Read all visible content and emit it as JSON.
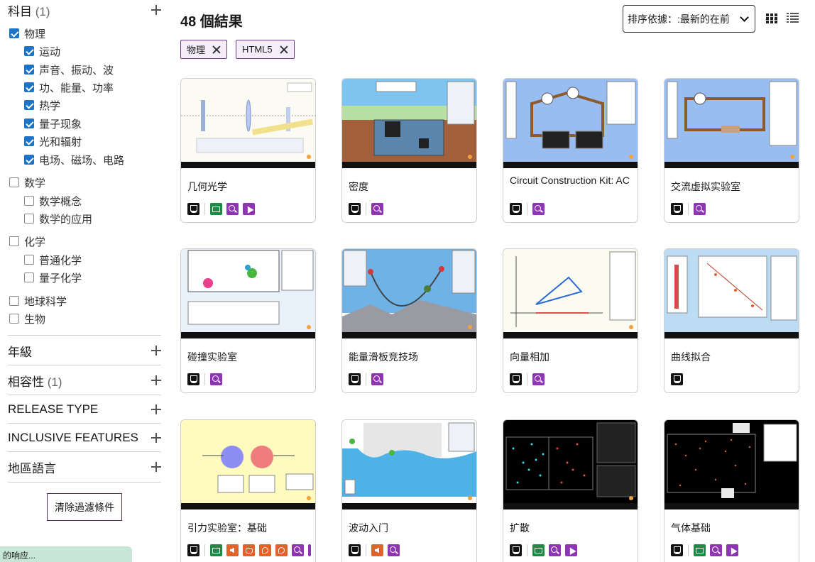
{
  "sidebar": {
    "subject": {
      "label": "科目",
      "count": "(1)"
    },
    "physics": {
      "label": "物理",
      "items": [
        "运动",
        "声音、振动、波",
        "功、能量、功率",
        "热学",
        "量子现象",
        "光和辐射",
        "电场、磁场、电路"
      ]
    },
    "math": {
      "label": "数学",
      "items": [
        "数学概念",
        "数学的应用"
      ]
    },
    "chemistry": {
      "label": "化学",
      "items": [
        "普通化学",
        "量子化学"
      ]
    },
    "earth": {
      "label": "地球科学"
    },
    "biology": {
      "label": "生物"
    },
    "facets": [
      {
        "label": "年級",
        "count": ""
      },
      {
        "label": "相容性",
        "count": "(1)"
      },
      {
        "label": "RELEASE TYPE",
        "count": ""
      },
      {
        "label": "INCLUSIVE FEATURES",
        "count": ""
      },
      {
        "label": "地區語言",
        "count": ""
      }
    ],
    "clear_label": "清除過濾條件",
    "status_text": "的响应..."
  },
  "header": {
    "results": "48 個結果",
    "sort_label": "排序依據：:最新的在前"
  },
  "chips": [
    "物理",
    "HTML5"
  ],
  "cards": [
    {
      "title": "几何光学",
      "badges": [
        "html5",
        "keyboard",
        "zoom",
        "pointer"
      ]
    },
    {
      "title": "密度",
      "badges": [
        "html5",
        "zoom"
      ]
    },
    {
      "title": "Circuit Construction Kit: AC",
      "badges": [
        "html5",
        "zoom"
      ]
    },
    {
      "title": "交流虚拟实验室",
      "badges": [
        "html5",
        "zoom"
      ]
    },
    {
      "title": "碰撞实验室",
      "badges": [
        "html5",
        "zoom"
      ]
    },
    {
      "title": "能量滑板竞技场",
      "badges": [
        "html5",
        "zoom"
      ]
    },
    {
      "title": "向量相加",
      "badges": [
        "html5",
        "zoom"
      ]
    },
    {
      "title": "曲线拟合",
      "badges": [
        "html5"
      ]
    },
    {
      "title": "引力实验室：基础",
      "badges": [
        "html5",
        "keyboard",
        "sound",
        "interactive-description",
        "voicing",
        "voicing-alt",
        "zoom",
        "pointer"
      ]
    },
    {
      "title": "波动入门",
      "badges": [
        "html5",
        "sound",
        "zoom"
      ]
    },
    {
      "title": "扩散",
      "badges": [
        "html5",
        "keyboard",
        "zoom",
        "pointer"
      ]
    },
    {
      "title": "气体基础",
      "badges": [
        "html5",
        "keyboard",
        "zoom",
        "pointer"
      ]
    }
  ],
  "colors": {
    "accent": "#6a3d84",
    "checkbox": "#1b74c7",
    "html5_badge": "#111111",
    "keyboard_badge": "#1e8a45",
    "zoom_badge": "#8f34b3",
    "sound_badge": "#e0642a"
  }
}
